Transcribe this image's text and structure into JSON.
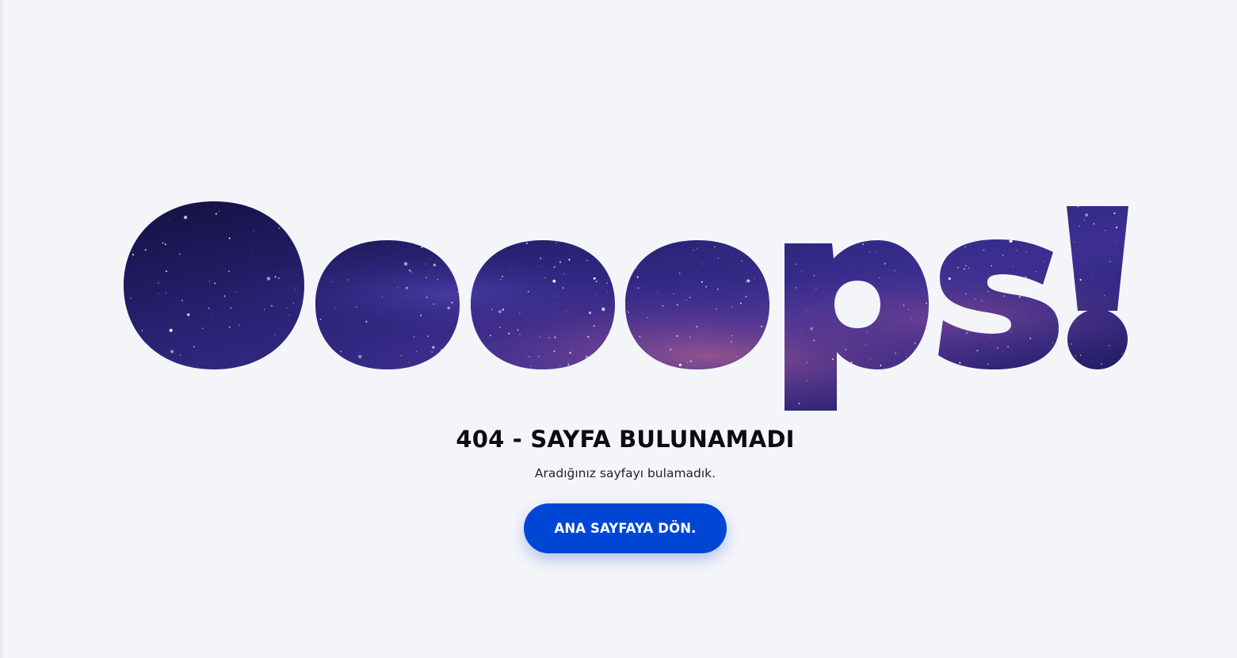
{
  "hero": {
    "text": "Oooops!",
    "fill_style": "starfield-galaxy"
  },
  "error": {
    "title": "404 - SAYFA BULUNAMADI",
    "message": "Aradığınız sayfayı bulamadık."
  },
  "actions": {
    "home_button_label": "ANA SAYFAYA DÖN."
  },
  "colors": {
    "page_background": "#f4f5f9",
    "button_background": "#0046d5",
    "button_text": "#ffffff",
    "title_text": "#0b0b10",
    "galaxy_dark": "#1c1652",
    "galaxy_mid": "#3b2d8f",
    "galaxy_glow": "#7a4a9a"
  }
}
